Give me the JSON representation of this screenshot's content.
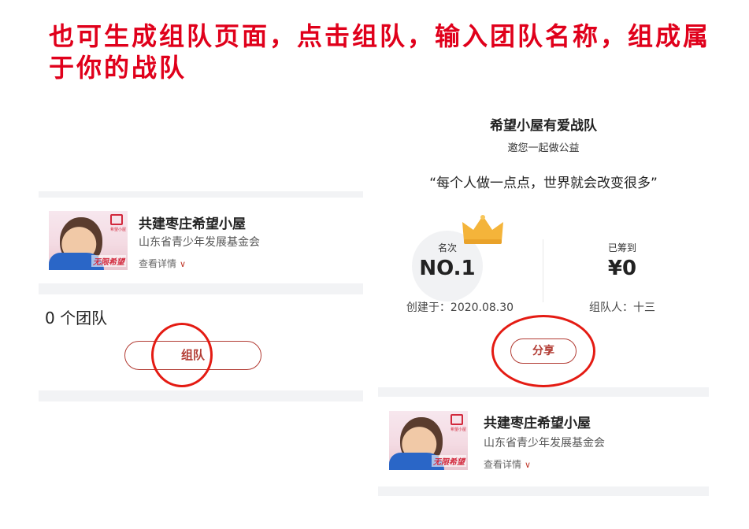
{
  "caption": "也可生成组队页面，点击组队，输入团队名称，组成属于你的战队",
  "left_panel": {
    "project": {
      "name": "共建枣庄希望小屋",
      "org": "山东省青少年发展基金会",
      "more": "查看详情",
      "thumb_house_label": "希望小屋",
      "thumb_slogan": "无限希望"
    },
    "team_count": "0 个团队",
    "team_button": "组队"
  },
  "right_panel": {
    "team_name": "希望小屋有爱战队",
    "invite": "邀您一起做公益",
    "quote": "“每个人做一点点，世界就会改变很多”",
    "rank_label": "名次",
    "rank_value": "NO.1",
    "raised_label": "已筹到",
    "raised_value": "¥0",
    "created": "创建于：2020.08.30",
    "leader": "组队人：十三",
    "share_button": "分享",
    "project": {
      "name": "共建枣庄希望小屋",
      "org": "山东省青少年发展基金会",
      "more": "查看详情",
      "thumb_house_label": "希望小屋",
      "thumb_slogan": "无限希望"
    }
  },
  "colors": {
    "caption": "#e0001b",
    "accent": "#b23b33",
    "annotation_ring": "#e41b13",
    "crown": "#f4b43a"
  }
}
